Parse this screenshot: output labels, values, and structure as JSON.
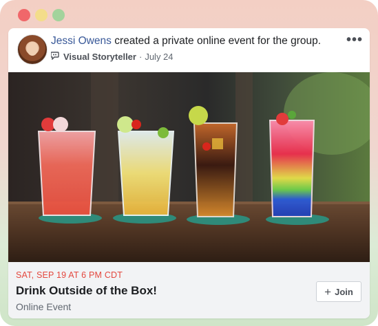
{
  "window": {
    "controls": [
      {
        "name": "close",
        "color": "#f0676a"
      },
      {
        "name": "minimize",
        "color": "#f3dd8a"
      },
      {
        "name": "maximize",
        "color": "#a3d39c"
      }
    ]
  },
  "post": {
    "author": "Jessi Owens",
    "action_text": "created a private online event for the group.",
    "group_name": "Visual Storyteller",
    "separator": "·",
    "date": "July 24",
    "more_label": "•••",
    "group_icon": "group-speech-icon",
    "avatar_icon": "profile-photo"
  },
  "event": {
    "date_time": "SAT, SEP 19 AT 6 PM CDT",
    "title": "Drink Outside of the Box!",
    "type": "Online Event",
    "join_label": "Join",
    "join_icon": "plus-icon",
    "photo": "four colorful cocktails on a wooden bar"
  }
}
